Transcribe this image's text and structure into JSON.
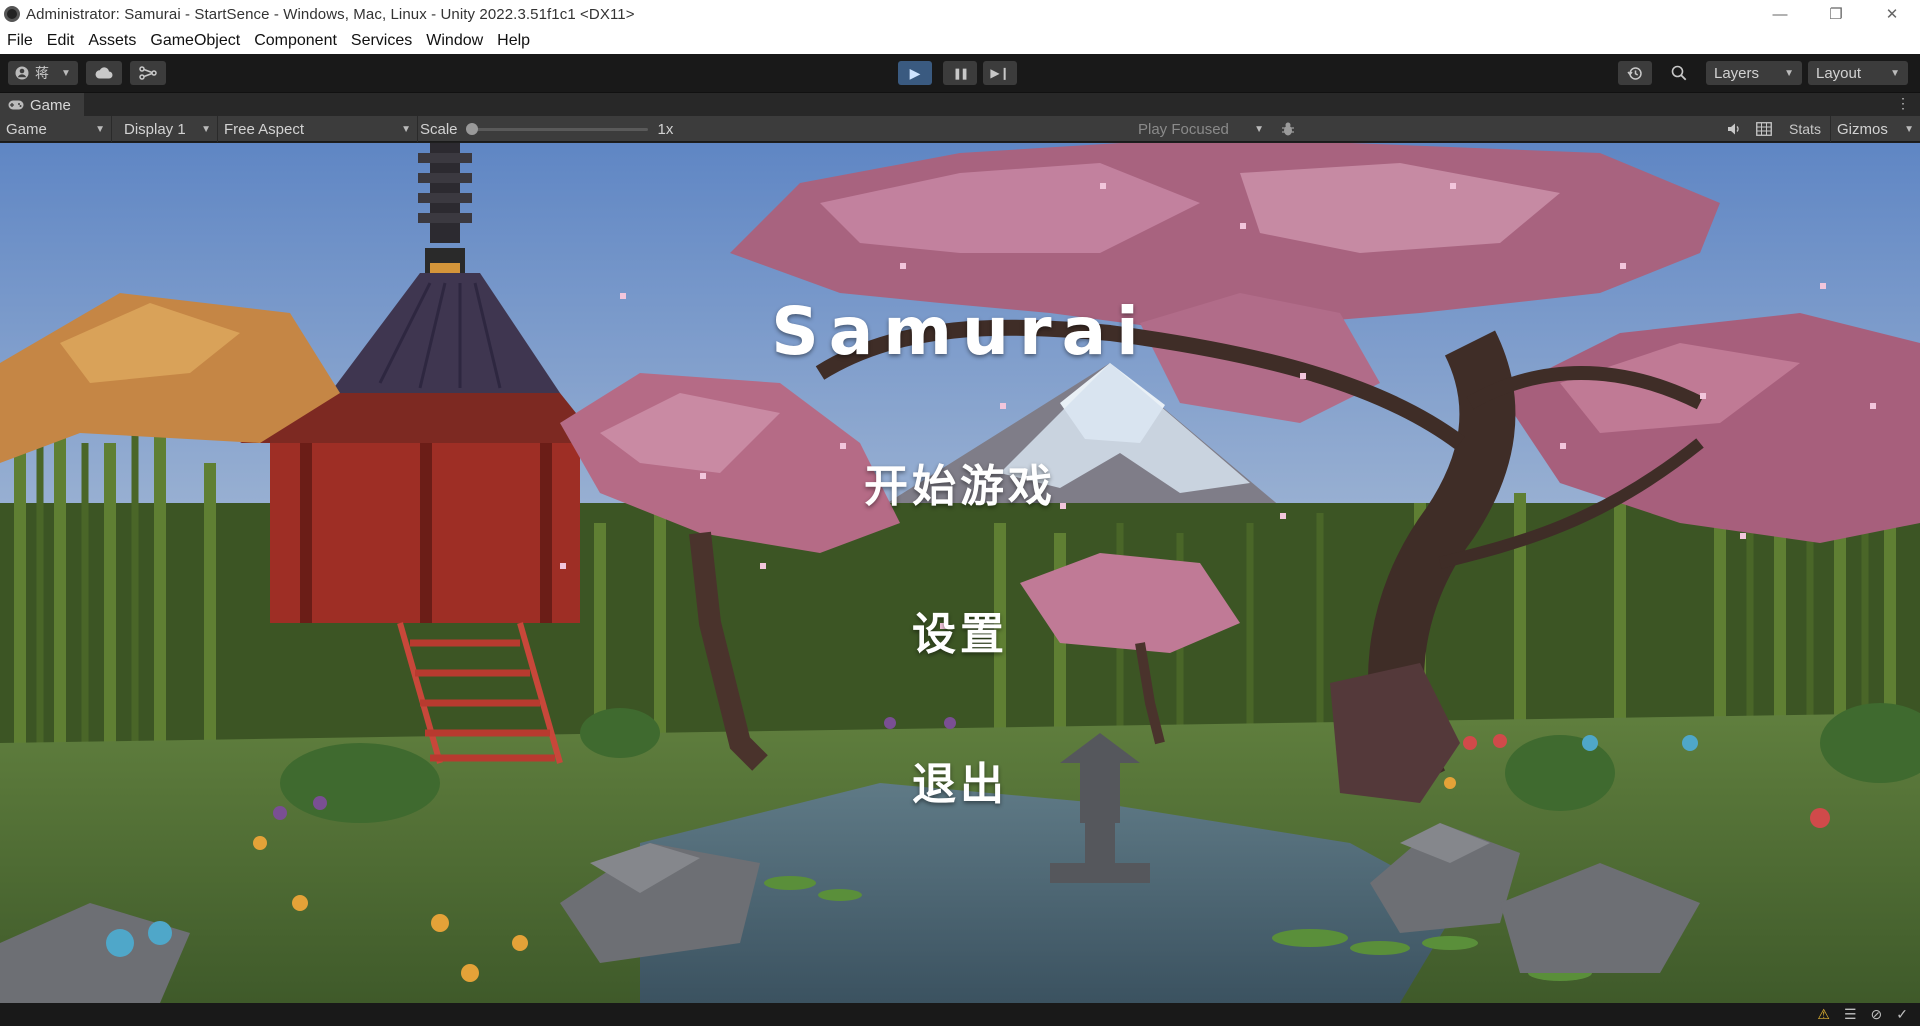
{
  "window": {
    "title": "Administrator: Samurai - StartSence - Windows, Mac, Linux - Unity 2022.3.51f1c1 <DX11>",
    "controls": {
      "minimize": "—",
      "restore": "❐",
      "close": "✕"
    }
  },
  "menubar": [
    "File",
    "Edit",
    "Assets",
    "GameObject",
    "Component",
    "Services",
    "Window",
    "Help"
  ],
  "toolbar": {
    "account_label": "蒋",
    "play_glyph": "▶",
    "pause_glyph": "❚❚",
    "step_glyph": "▶❙",
    "layers_label": "Layers",
    "layout_label": "Layout",
    "play_active": true
  },
  "tab": {
    "label": "Game"
  },
  "gamebar": {
    "view_mode": "Game",
    "display": "Display 1",
    "aspect": "Free Aspect",
    "scale_label": "Scale",
    "scale_value": "1x",
    "scale_fraction": 0.0,
    "play_focused": "Play Focused",
    "stats_label": "Stats",
    "gizmos_label": "Gizmos"
  },
  "game": {
    "title": "Samurai",
    "buttons": [
      "开始游戏",
      "设置",
      "退出"
    ]
  },
  "colors": {
    "sky_top": "#5f86c4",
    "sky_bottom": "#c6d3e0",
    "blossom": "#b56b86",
    "bamboo": "#4f6b2c",
    "grass": "#56793a",
    "temple_red": "#9e2e25",
    "roof": "#3f3650"
  }
}
